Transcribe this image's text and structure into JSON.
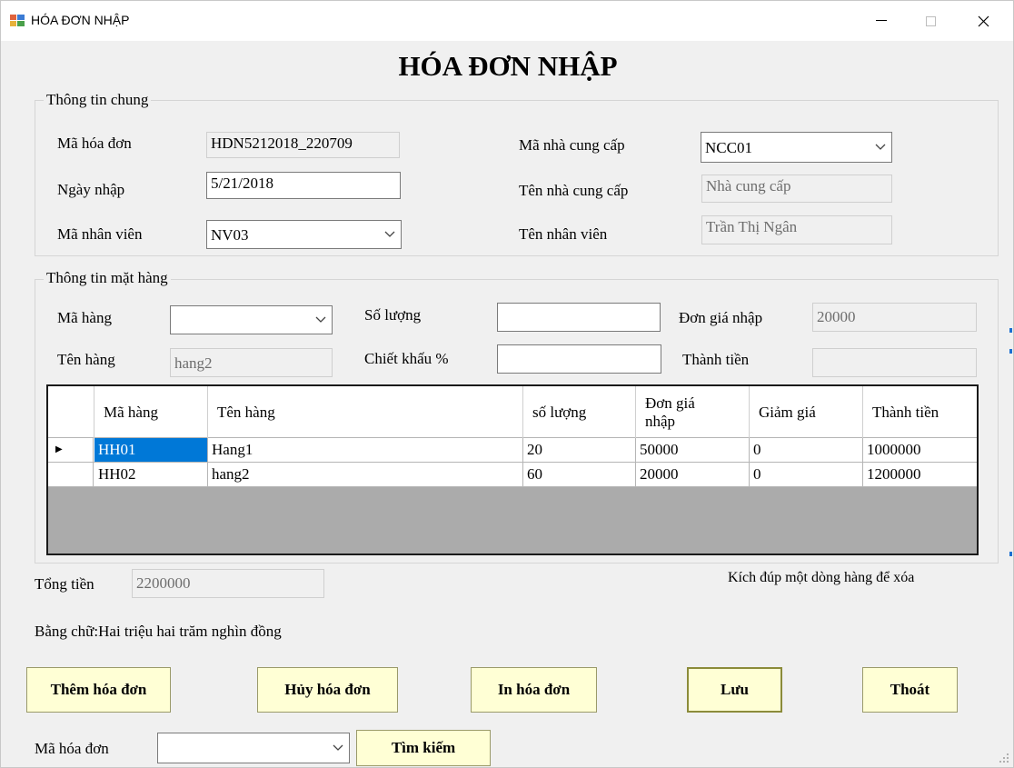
{
  "window": {
    "title": "HÓA ĐƠN NHẬP",
    "controls": {
      "minimize": "—",
      "maximize": "☐",
      "close": "✕"
    }
  },
  "heading": "HÓA ĐƠN NHẬP",
  "general": {
    "group_title": "Thông tin chung",
    "invoice_id_label": "Mã hóa đơn",
    "invoice_id_value": "HDN5212018_220709",
    "date_label": "Ngày nhập",
    "date_value": "5/21/2018",
    "employee_id_label": "Mã nhân viên",
    "employee_id_value": "NV03",
    "supplier_id_label": "Mã nhà cung cấp",
    "supplier_id_value": "NCC01",
    "supplier_name_label": "Tên nhà cung cấp",
    "supplier_name_value": "Nhà cung cấp",
    "employee_name_label": "Tên nhân viên",
    "employee_name_value": "Trần Thị Ngân"
  },
  "item": {
    "group_title": "Thông tin mặt hàng",
    "code_label": "Mã hàng",
    "code_value": "",
    "name_label": "Tên hàng",
    "name_value": "hang2",
    "qty_label": "Số lượng",
    "qty_value": "",
    "discount_label": "Chiết khấu %",
    "discount_value": "",
    "unit_price_label": "Đơn giá nhập",
    "unit_price_value": "20000",
    "amount_label": "Thành tiền",
    "amount_value": ""
  },
  "grid": {
    "columns": [
      "Mã hàng",
      "Tên hàng",
      "số lượng",
      "Đơn giá nhập",
      "Giảm giá",
      "Thành tiền"
    ],
    "rows": [
      [
        "HH01",
        "Hang1",
        "20",
        "50000",
        "0",
        "1000000"
      ],
      [
        "HH02",
        "hang2",
        "60",
        "20000",
        "0",
        "1200000"
      ]
    ],
    "current_row_marker": "▶"
  },
  "total": {
    "label": "Tổng tiền",
    "value": "2200000",
    "hint": "Kích đúp một dòng hàng để xóa",
    "in_words": "Bằng chữ:Hai triệu hai trăm nghìn đồng"
  },
  "buttons": {
    "add": "Thêm hóa đơn",
    "cancel": "Hủy hóa đơn",
    "print": "In hóa đơn",
    "save": "Lưu",
    "exit": "Thoát",
    "search": "Tìm kiếm"
  },
  "search": {
    "label": "Mã hóa đơn",
    "value": ""
  },
  "colors": {
    "window_bg": "#f0f0f0",
    "button_bg": "#ffffd5",
    "selection": "#0078d7",
    "grid_empty": "#ababab"
  }
}
